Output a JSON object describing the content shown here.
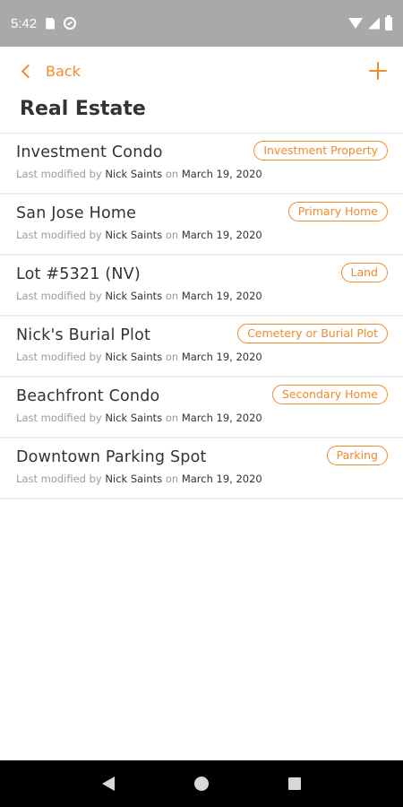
{
  "status_bar": {
    "time": "5:42",
    "icons": [
      "sim-card-icon",
      "data-saver-icon",
      "wifi-icon",
      "signal-icon",
      "battery-icon"
    ]
  },
  "header": {
    "back_label": "Back",
    "title": "Real Estate",
    "add_icon": "plus-icon"
  },
  "colors": {
    "accent": "#f08a2c",
    "status_bar": "#a9a9a9",
    "nav_bar": "#000000"
  },
  "items": [
    {
      "name": "Investment Condo",
      "tag": "Investment Property",
      "meta_prefix": "Last modified by",
      "author": "Nick Saints",
      "meta_mid": "on",
      "date": "March 19, 2020"
    },
    {
      "name": "San Jose Home",
      "tag": "Primary Home",
      "meta_prefix": "Last modified by",
      "author": "Nick Saints",
      "meta_mid": "on",
      "date": "March 19, 2020"
    },
    {
      "name": "Lot #5321 (NV)",
      "tag": "Land",
      "meta_prefix": "Last modified by",
      "author": "Nick Saints",
      "meta_mid": "on",
      "date": "March 19, 2020"
    },
    {
      "name": "Nick's Burial Plot",
      "tag": "Cemetery or Burial Plot",
      "meta_prefix": "Last modified by",
      "author": "Nick Saints",
      "meta_mid": "on",
      "date": "March 19, 2020"
    },
    {
      "name": "Beachfront Condo",
      "tag": "Secondary Home",
      "meta_prefix": "Last modified by",
      "author": "Nick Saints",
      "meta_mid": "on",
      "date": "March 19, 2020"
    },
    {
      "name": "Downtown Parking Spot",
      "tag": "Parking",
      "meta_prefix": "Last modified by",
      "author": "Nick Saints",
      "meta_mid": "on",
      "date": "March 19, 2020"
    }
  ],
  "nav_bar": {
    "icons": [
      "back-triangle-icon",
      "home-circle-icon",
      "recents-square-icon"
    ]
  }
}
